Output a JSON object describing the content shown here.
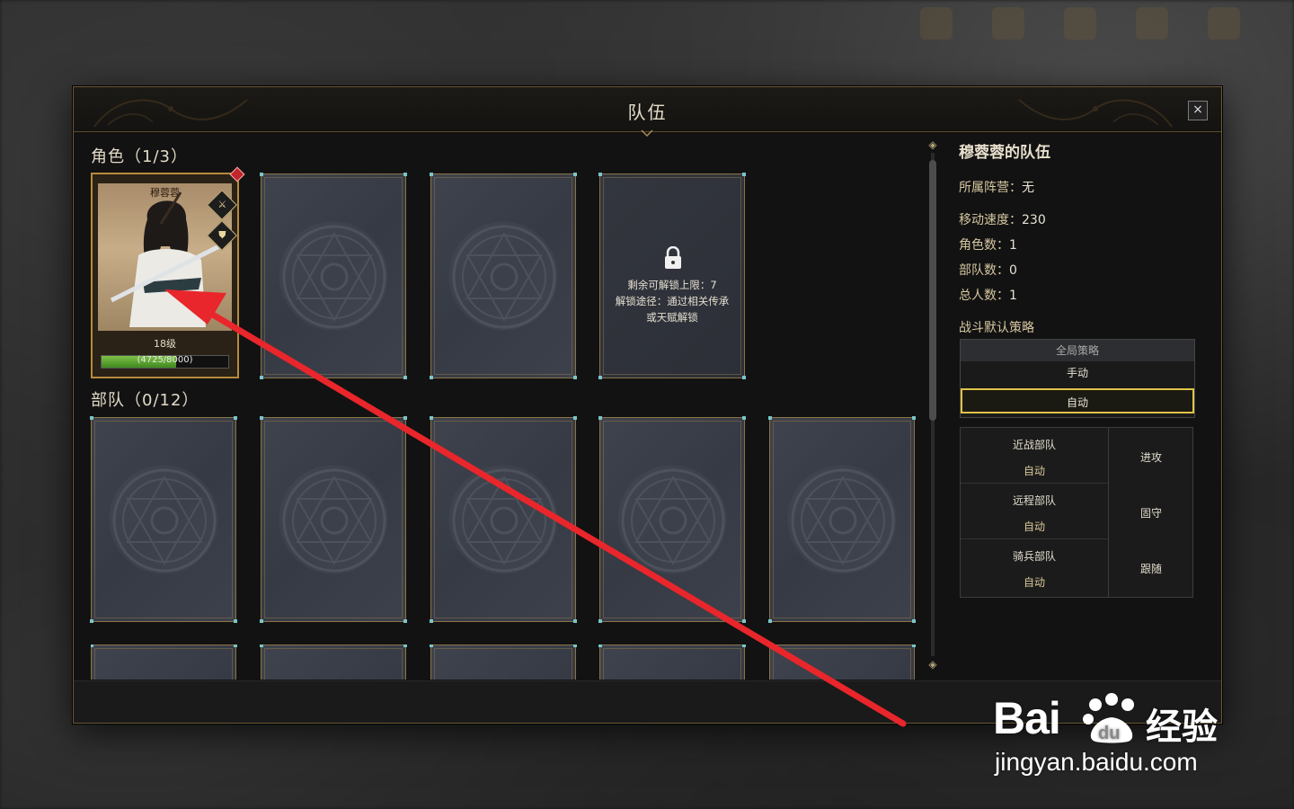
{
  "dialog": {
    "title": "队伍",
    "close_label": "×"
  },
  "characters": {
    "section_title": "角色（1/3）",
    "hero": {
      "name": "穆蓉蓉",
      "level": "18级",
      "exp_text": "(4725/8000)",
      "exp_fraction": 0.59,
      "weapon_icon": "sword-icon",
      "armor_icon": "shield-icon"
    },
    "locked_slot": {
      "line1": "剩余可解锁上限：7",
      "line2": "解锁途径：通过相关传承",
      "line3": "或天赋解锁"
    }
  },
  "troops": {
    "section_title": "部队（0/12）"
  },
  "team_info": {
    "team_name": "穆蓉蓉的队伍",
    "faction_label": "所属阵营：",
    "faction_value": "无",
    "move_speed_label": "移动速度：",
    "move_speed_value": "230",
    "char_count_label": "角色数：",
    "char_count_value": "1",
    "troop_count_label": "部队数：",
    "troop_count_value": "0",
    "total_count_label": "总人数：",
    "total_count_value": "1",
    "strategy_title": "战斗默认策略"
  },
  "strategy": {
    "header": "全局策略",
    "manual": "手动",
    "auto": "自动",
    "selected": "auto"
  },
  "troop_strategy": {
    "rows": [
      {
        "name": "近战部队",
        "mode": "自动",
        "action": "进攻"
      },
      {
        "name": "远程部队",
        "mode": "自动",
        "action": "固守"
      },
      {
        "name": "骑兵部队",
        "mode": "自动",
        "action": "跟随"
      }
    ]
  },
  "watermark": {
    "logo_text": "Bai",
    "logo_du": "du",
    "cn_text": "经验",
    "url": "jingyan.baidu.com"
  },
  "colors": {
    "accent_gold": "#b78a3b",
    "selected_border": "#e0c24a",
    "exp_green": "#6bb23a",
    "annotation_arrow": "#e8262b"
  }
}
